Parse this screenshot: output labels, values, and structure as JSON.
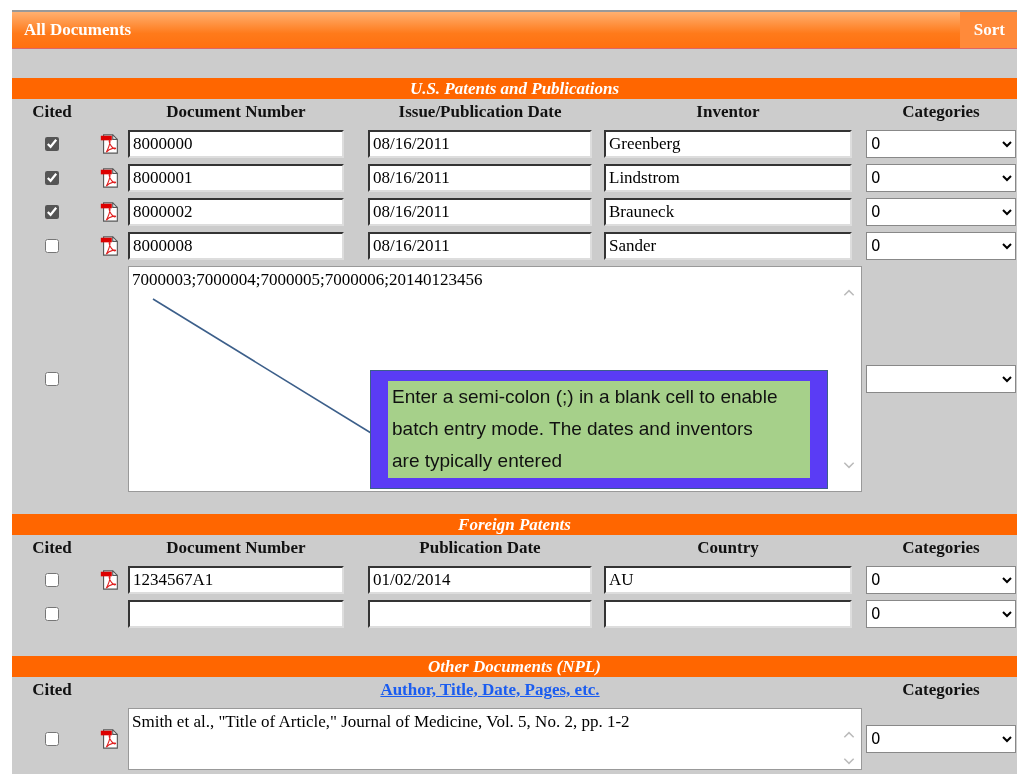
{
  "header": {
    "title": "All Documents",
    "sort": "Sort"
  },
  "sections": [
    {
      "title": "U.S. Patents and Publications",
      "columns": [
        {
          "label": "Cited",
          "kind": "text"
        },
        {
          "label": "Document Number",
          "kind": "text"
        },
        {
          "label": "Issue/Publication Date",
          "kind": "text"
        },
        {
          "label": "Inventor",
          "kind": "text"
        },
        {
          "label": "Categories",
          "kind": "text"
        }
      ],
      "rows": [
        {
          "kind": "entry",
          "cited": true,
          "pdf": true,
          "number": "8000000",
          "date": "08/16/2011",
          "name": "Greenberg",
          "category": "0"
        },
        {
          "kind": "entry",
          "cited": true,
          "pdf": true,
          "number": "8000001",
          "date": "08/16/2011",
          "name": "Lindstrom",
          "category": "0"
        },
        {
          "kind": "entry",
          "cited": true,
          "pdf": true,
          "number": "8000002",
          "date": "08/16/2011",
          "name": "Brauneck",
          "category": "0"
        },
        {
          "kind": "entry",
          "cited": false,
          "pdf": true,
          "number": "8000008",
          "date": "08/16/2011",
          "name": "Sander",
          "category": "0"
        },
        {
          "kind": "batch",
          "cited": false,
          "pdf": false,
          "text": "7000003;7000004;7000005;7000006;20140123456",
          "callout": "Enter a semi-colon (;) in a blank cell to enable batch entry mode. The dates and inventors are typically entered"
        }
      ]
    },
    {
      "title": "Foreign Patents",
      "columns": [
        {
          "label": "Cited",
          "kind": "text"
        },
        {
          "label": "Document Number",
          "kind": "text"
        },
        {
          "label": "Publication Date",
          "kind": "text"
        },
        {
          "label": "Country",
          "kind": "text"
        },
        {
          "label": "Categories",
          "kind": "text"
        }
      ],
      "rows": [
        {
          "kind": "entry",
          "cited": false,
          "pdf": true,
          "number": "1234567A1",
          "date": "01/02/2014",
          "name": "AU",
          "category": "0"
        },
        {
          "kind": "entry",
          "cited": false,
          "pdf": false,
          "category": "0"
        }
      ]
    },
    {
      "title": "Other Documents (NPL)",
      "columns": [
        {
          "label": "Cited",
          "kind": "text"
        },
        {
          "label": "Author, Title, Date, Pages, etc.",
          "kind": "link"
        },
        {
          "label": "Categories",
          "kind": "text"
        }
      ],
      "rows": [
        {
          "kind": "citation",
          "cited": false,
          "pdf": true,
          "text": "Smith et al., \"Title of Article,\" Journal of Medicine, Vol. 5, No. 2, pp. 1-2",
          "category": "0"
        }
      ]
    }
  ]
}
